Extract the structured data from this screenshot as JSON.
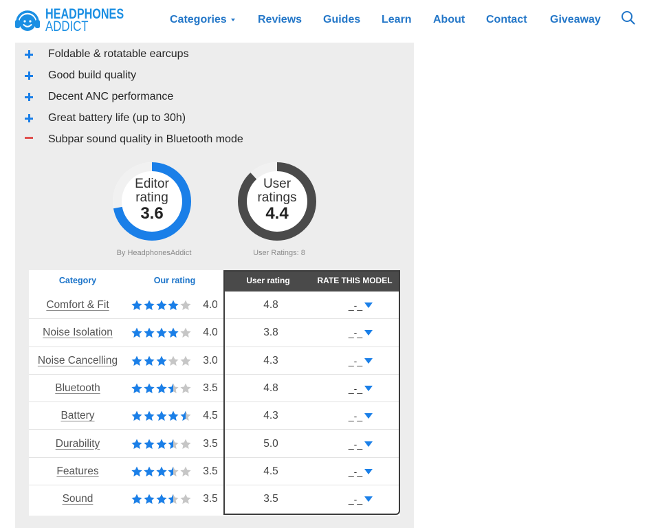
{
  "header": {
    "logo": {
      "line1": "HEADPHONES",
      "line2": "ADDICT",
      "icon": "headphones-face-logo-icon"
    },
    "nav": [
      {
        "label": "Categories",
        "dropdown": true
      },
      {
        "label": "Reviews"
      },
      {
        "label": "Guides"
      },
      {
        "label": "Learn"
      },
      {
        "label": "About"
      },
      {
        "label": "Contact"
      },
      {
        "label": "Giveaway"
      }
    ],
    "search_icon": "search-icon"
  },
  "pros_cons": [
    {
      "type": "pro",
      "icon": "plus-icon",
      "text": "Foldable & rotatable earcups"
    },
    {
      "type": "pro",
      "icon": "plus-icon",
      "text": "Good build quality"
    },
    {
      "type": "pro",
      "icon": "plus-icon",
      "text": "Decent ANC performance"
    },
    {
      "type": "pro",
      "icon": "plus-icon",
      "text": "Great battery life (up to 30h)"
    },
    {
      "type": "con",
      "icon": "minus-icon",
      "text": "Subpar sound quality in Bluetooth mode"
    }
  ],
  "ratings": {
    "editor": {
      "label_line1": "Editor",
      "label_line2": "rating",
      "value": "3.6",
      "ring_fill": 0.72,
      "caption": "By HeadphonesAddict",
      "color": "#1a7fe8"
    },
    "user": {
      "label_line1": "User",
      "label_line2": "ratings",
      "value": "4.4",
      "ring_fill": 0.88,
      "caption": "User Ratings: 8",
      "color": "#4a4a4a"
    }
  },
  "table": {
    "headers": {
      "category": "Category",
      "our_rating": "Our rating",
      "user_rating": "User rating",
      "rate": "RATE THIS MODEL"
    },
    "rate_placeholder": "_-_",
    "rows": [
      {
        "category": "Comfort & Fit",
        "our_rating": "4.0",
        "user_rating": "4.8"
      },
      {
        "category": "Noise Isolation",
        "our_rating": "4.0",
        "user_rating": "3.8"
      },
      {
        "category": "Noise Cancelling",
        "our_rating": "3.0",
        "user_rating": "4.3"
      },
      {
        "category": "Bluetooth",
        "our_rating": "3.5",
        "user_rating": "4.8"
      },
      {
        "category": "Battery",
        "our_rating": "4.5",
        "user_rating": "4.3"
      },
      {
        "category": "Durability",
        "our_rating": "3.5",
        "user_rating": "5.0"
      },
      {
        "category": "Features",
        "our_rating": "3.5",
        "user_rating": "4.5"
      },
      {
        "category": "Sound",
        "our_rating": "3.5",
        "user_rating": "3.5"
      }
    ]
  },
  "colors": {
    "accent": "#1a7fe8",
    "nav": "#2477c8",
    "logo": "#1b8fe3",
    "con": "#e0504e",
    "star_empty": "#c6c6c6",
    "panel": "#ededed",
    "dark_header": "#4a4a4a"
  }
}
